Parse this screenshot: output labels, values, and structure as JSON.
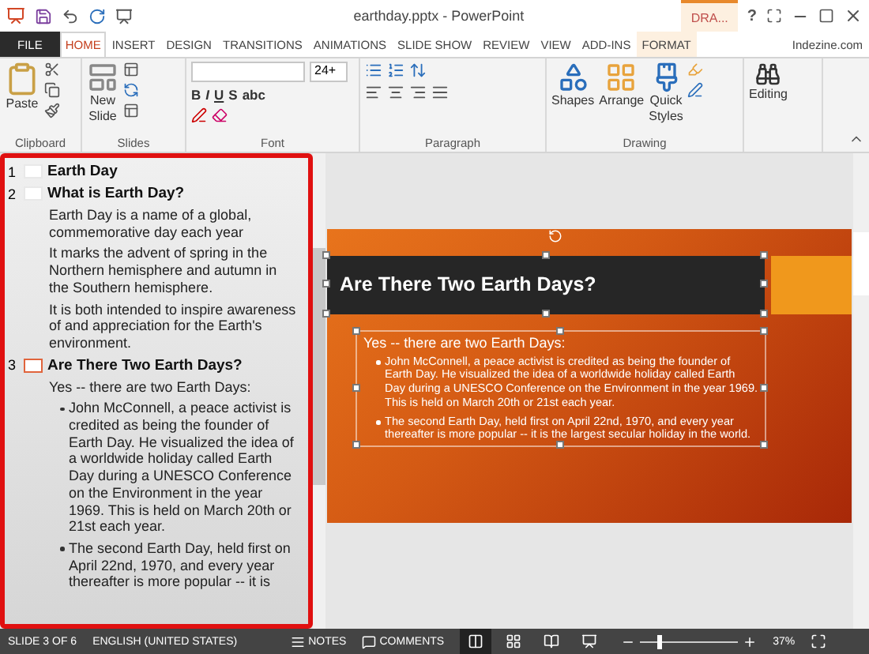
{
  "title_bar": {
    "title": "earthday.pptx - PowerPoint",
    "contextual_tab": "DRA...",
    "help": "?"
  },
  "tabs": [
    {
      "label": "FILE",
      "kind": "file",
      "selected": false
    },
    {
      "label": "HOME",
      "kind": "tab",
      "selected": true
    },
    {
      "label": "INSERT",
      "kind": "tab",
      "selected": false
    },
    {
      "label": "DESIGN",
      "kind": "tab",
      "selected": false
    },
    {
      "label": "TRANSITIONS",
      "kind": "tab",
      "selected": false
    },
    {
      "label": "ANIMATIONS",
      "kind": "tab",
      "selected": false
    },
    {
      "label": "SLIDE SHOW",
      "kind": "tab",
      "selected": false
    },
    {
      "label": "REVIEW",
      "kind": "tab",
      "selected": false
    },
    {
      "label": "VIEW",
      "kind": "tab",
      "selected": false
    },
    {
      "label": "ADD-INS",
      "kind": "tab",
      "selected": false
    },
    {
      "label": "FORMAT",
      "kind": "contextual",
      "selected": false
    }
  ],
  "account": "Indezine.com",
  "ribbon": {
    "clipboard": {
      "label": "Clipboard",
      "paste": "Paste"
    },
    "slides": {
      "label": "Slides",
      "new_slide": [
        "New",
        "Slide"
      ]
    },
    "font": {
      "label": "Font",
      "size": "24+",
      "buttons": [
        "B",
        "I",
        "U",
        "S",
        "abc"
      ]
    },
    "paragraph": {
      "label": "Paragraph"
    },
    "drawing": {
      "label": "Drawing",
      "shapes": "Shapes",
      "arrange": "Arrange",
      "quick_styles": [
        "Quick",
        "Styles"
      ]
    },
    "editing": {
      "label": "Editing"
    }
  },
  "outline": [
    {
      "number": "1",
      "title": "Earth Day",
      "selected": false
    },
    {
      "number": "2",
      "title": "What is Earth Day?",
      "selected": false,
      "body": [
        {
          "kind": "para",
          "text": "Earth Day is a name of a global, commemorative day each year"
        },
        {
          "kind": "para",
          "text": "It marks the advent of spring in the Northern hemisphere and autumn in the Southern hemisphere."
        },
        {
          "kind": "para",
          "text": "It is both intended to inspire awareness of and appreciation for the Earth's environment."
        }
      ]
    },
    {
      "number": "3",
      "title": "Are There Two Earth Days?",
      "selected": true,
      "body": [
        {
          "kind": "para",
          "text": "Yes -- there are two Earth Days:"
        },
        {
          "kind": "bullet",
          "text": "John McConnell, a peace activist is credited as being the founder of Earth Day. He visualized the idea of a worldwide holiday called Earth Day during a UNESCO Conference on the Environment in the year 1969. This is held on March 20th or 21st each year."
        },
        {
          "kind": "bullet",
          "text": "The second Earth Day, held first on April 22nd, 1970, and every year thereafter is more popular -- it is"
        }
      ]
    }
  ],
  "slide": {
    "title": "Are There Two Earth Days?",
    "subtitle": "Yes -- there are two Earth Days:",
    "bullets": [
      "John McConnell, a peace activist is credited as being the founder of Earth Day. He visualized the idea of a worldwide holiday called Earth Day during a UNESCO Conference on the Environment in the year 1969. This is held on March 20th or 21st each year.",
      "The second Earth Day, held first on April 22nd, 1970, and every year thereafter is more popular -- it is the largest secular holiday in the world."
    ]
  },
  "status_bar": {
    "slide": "SLIDE 3 OF 6",
    "language": "ENGLISH (UNITED STATES)",
    "notes": "NOTES",
    "comments": "COMMENTS",
    "views": [
      {
        "kind": "normal",
        "selected": true
      },
      {
        "kind": "sorter",
        "selected": false
      },
      {
        "kind": "reading",
        "selected": false
      },
      {
        "kind": "show",
        "selected": false
      }
    ],
    "zoom": {
      "level": 0.2,
      "reading": "37%"
    }
  }
}
